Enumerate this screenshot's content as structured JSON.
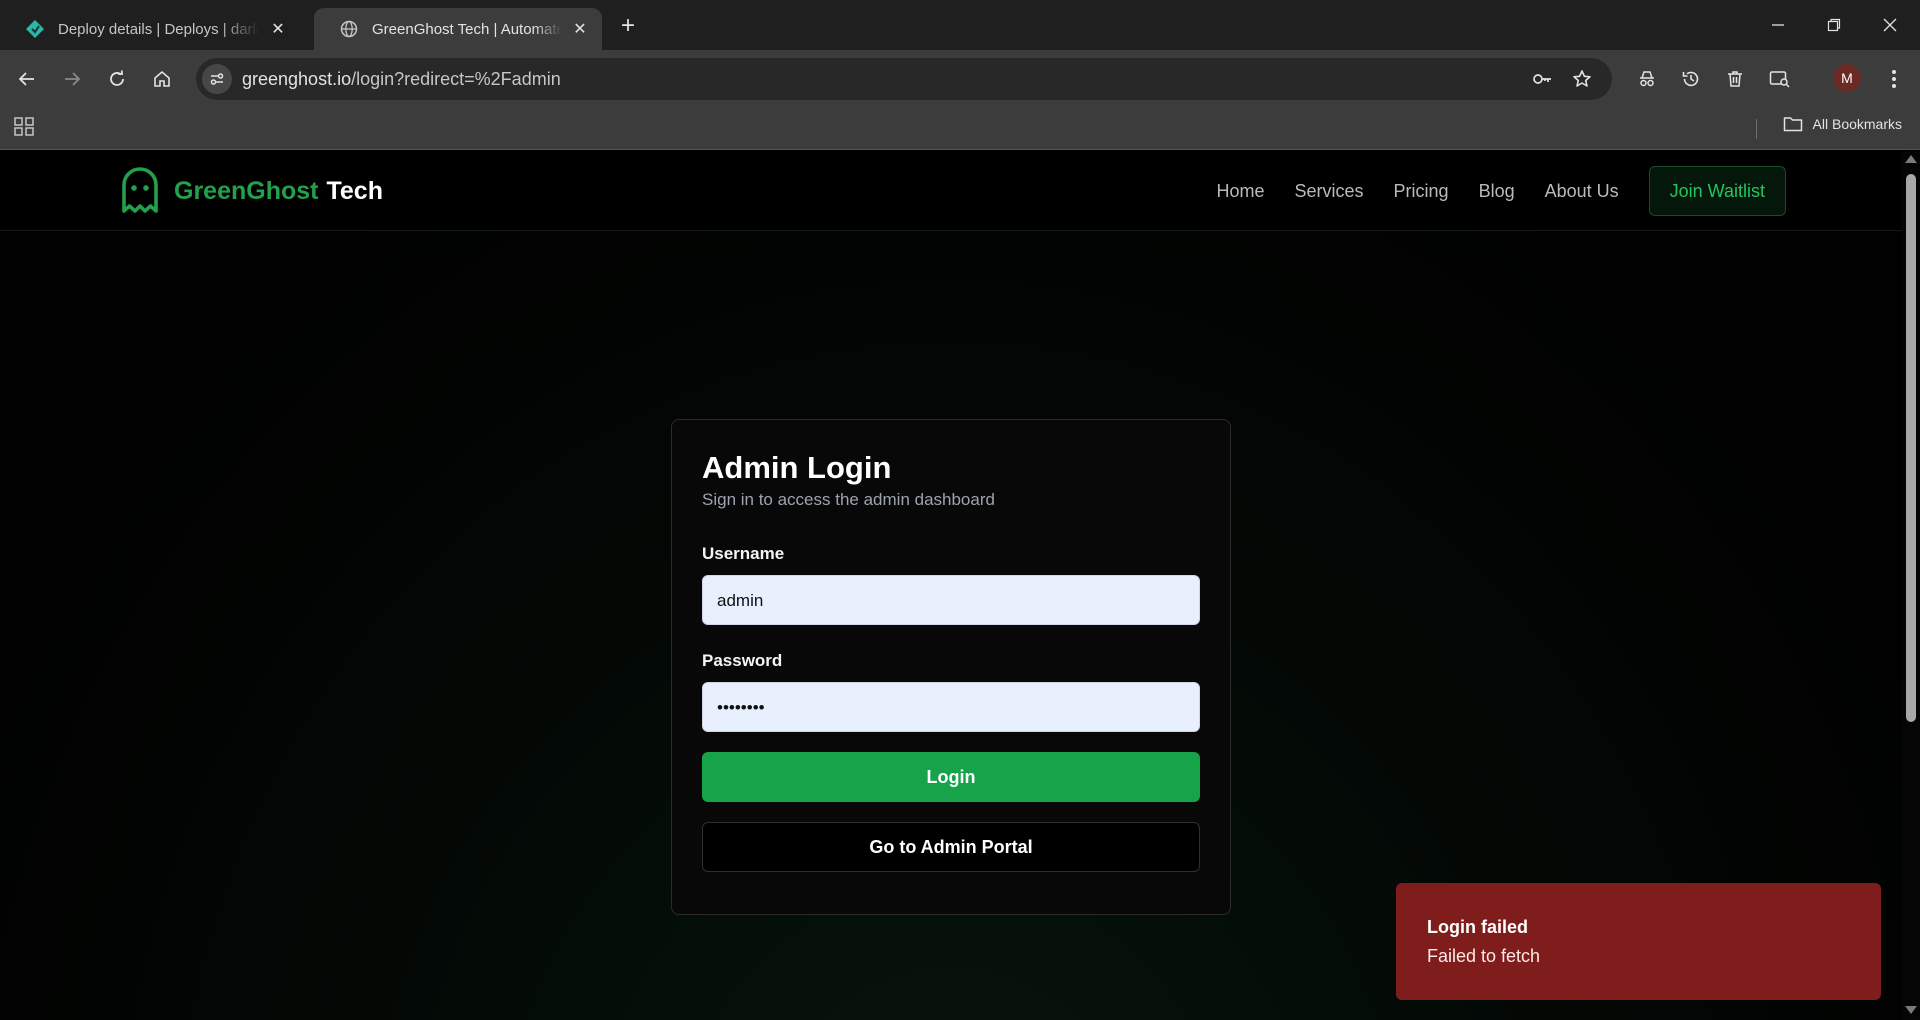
{
  "browser": {
    "tabs": [
      {
        "title": "Deploy details | Deploys | darling",
        "favicon": "netlify-icon",
        "active": false
      },
      {
        "title": "GreenGhost Tech | Automated Lead",
        "favicon": "globe-icon",
        "active": true
      }
    ],
    "address": {
      "domain": "greenghost.io",
      "path": "/login?redirect=%2Fadmin"
    },
    "profile_initial": "M",
    "bookmarks_label": "All Bookmarks"
  },
  "site": {
    "logo_green": "GreenGhost",
    "logo_white": "Tech",
    "nav": [
      "Home",
      "Services",
      "Pricing",
      "Blog",
      "About Us"
    ],
    "cta": "Join Waitlist"
  },
  "login": {
    "title": "Admin Login",
    "subtitle": "Sign in to access the admin dashboard",
    "username_label": "Username",
    "username_value": "admin",
    "password_label": "Password",
    "password_value": "••••••••",
    "login_button": "Login",
    "portal_button": "Go to Admin Portal"
  },
  "toast": {
    "title": "Login failed",
    "message": "Failed to fetch"
  },
  "colors": {
    "brand_green": "#22a04b",
    "button_green": "#16a34a",
    "toast_red": "#7f1d1d"
  }
}
